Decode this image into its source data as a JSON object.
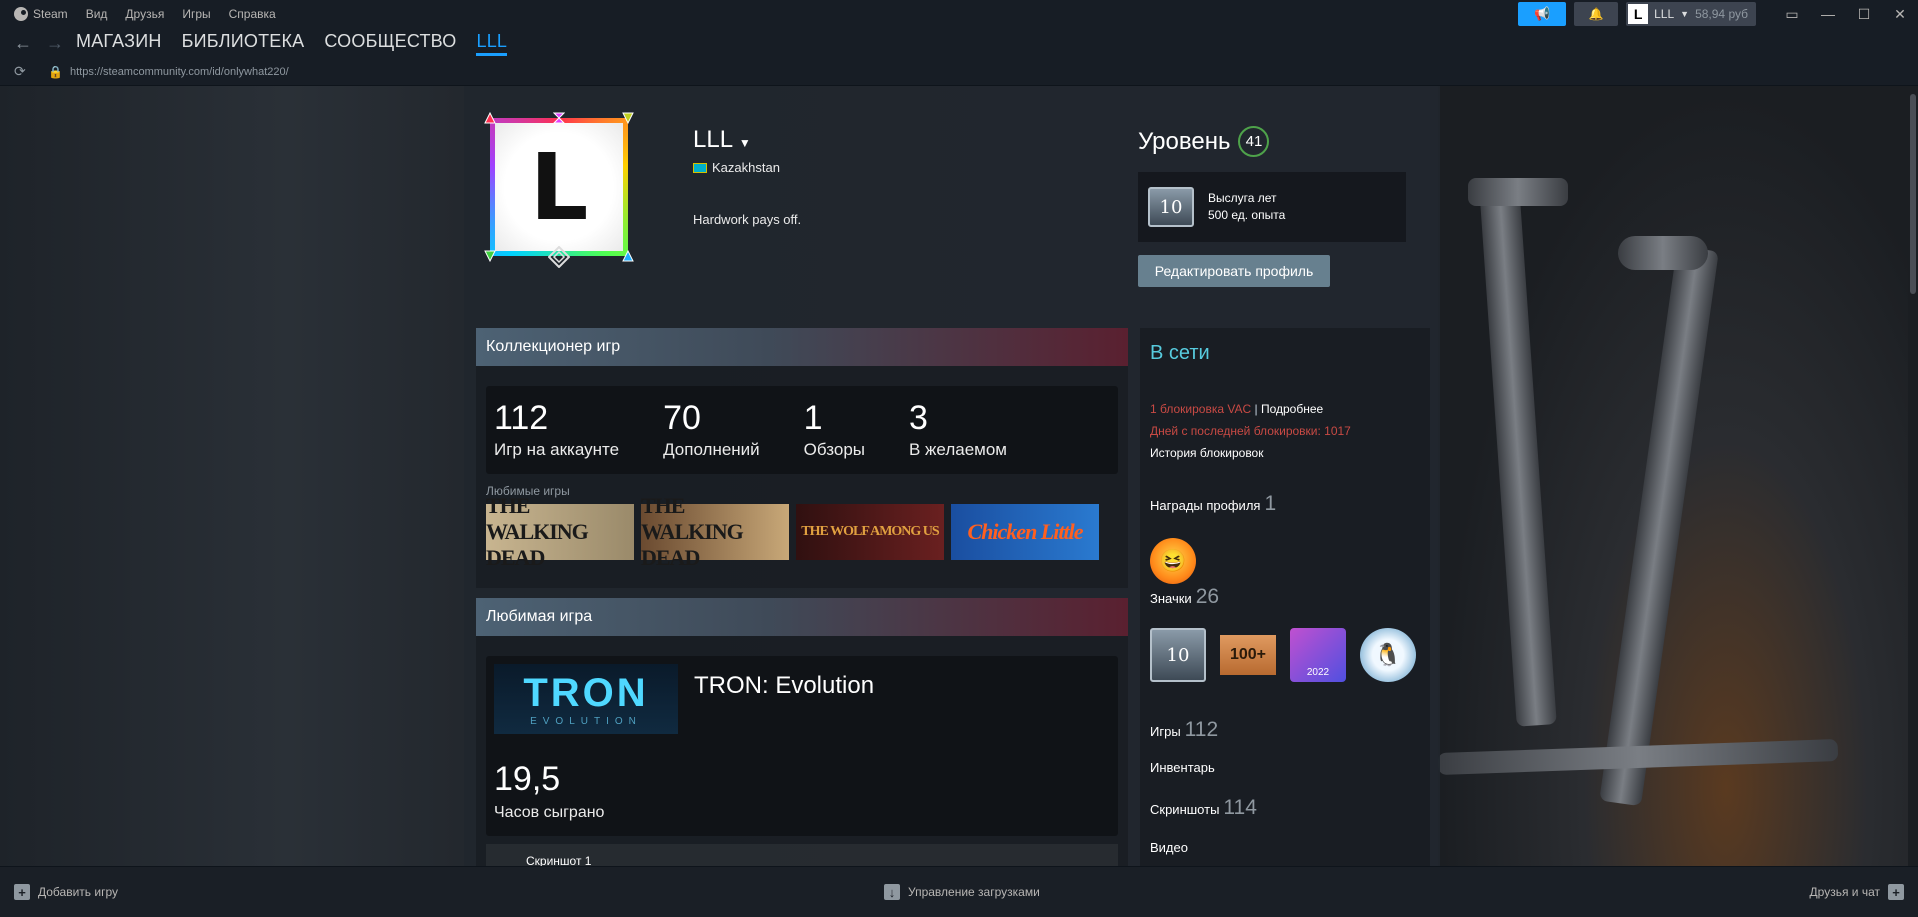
{
  "titlebar": {
    "menu": [
      "Steam",
      "Вид",
      "Друзья",
      "Игры",
      "Справка"
    ],
    "account_initial": "L",
    "account_name": "LLL",
    "balance": "58,94 руб"
  },
  "nav": {
    "tabs": [
      "МАГАЗИН",
      "БИБЛИОТЕКА",
      "СООБЩЕСТВО",
      "LLL"
    ],
    "active_tab": "LLL",
    "url": "https://steamcommunity.com/id/onlywhat220/"
  },
  "profile": {
    "avatar_letter": "L",
    "name": "LLL",
    "country": "Kazakhstan",
    "summary": "Hardwork pays off.",
    "level_label": "Уровень",
    "level": "41",
    "badge": {
      "value": "10",
      "title": "Выслуга лет",
      "xp": "500 ед. опыта"
    },
    "edit_button": "Редактировать профиль"
  },
  "collector": {
    "title": "Коллекционер игр",
    "stats": [
      {
        "num": "112",
        "label": "Игр на аккаунте"
      },
      {
        "num": "70",
        "label": "Дополнений"
      },
      {
        "num": "1",
        "label": "Обзоры"
      },
      {
        "num": "3",
        "label": "В желаемом"
      }
    ],
    "fav_label": "Любимые игры",
    "fav_games": [
      "THE WALKING DEAD",
      "THE WALKING DEAD",
      "THE WOLF AMONG US",
      "Chicken Little"
    ]
  },
  "favorite_game": {
    "title": "Любимая игра",
    "image_text": "TRON",
    "image_sub": "EVOLUTION",
    "name": "TRON: Evolution",
    "hours": "19,5",
    "hours_label": "Часов сыграно",
    "screenshot_label": "Скриншот 1"
  },
  "sidebar": {
    "status": "В сети",
    "vac": "1 блокировка VAC",
    "vac_sep": "|",
    "vac_more": "Подробнее",
    "vac_days": "Дней с последней блокировки: 1017",
    "vac_history": "История блокировок",
    "awards_label": "Награды профиля",
    "awards_count": "1",
    "badges_label": "Значки",
    "badges_count": "26",
    "badge_items": [
      "10",
      "100+",
      "2022",
      "🐧"
    ],
    "games_label": "Игры",
    "games_count": "112",
    "inventory_label": "Инвентарь",
    "screenshots_label": "Скриншоты",
    "screenshots_count": "114",
    "video_label": "Видео"
  },
  "bottom": {
    "add_game": "Добавить игру",
    "downloads": "Управление загрузками",
    "friends": "Друзья и чат"
  }
}
